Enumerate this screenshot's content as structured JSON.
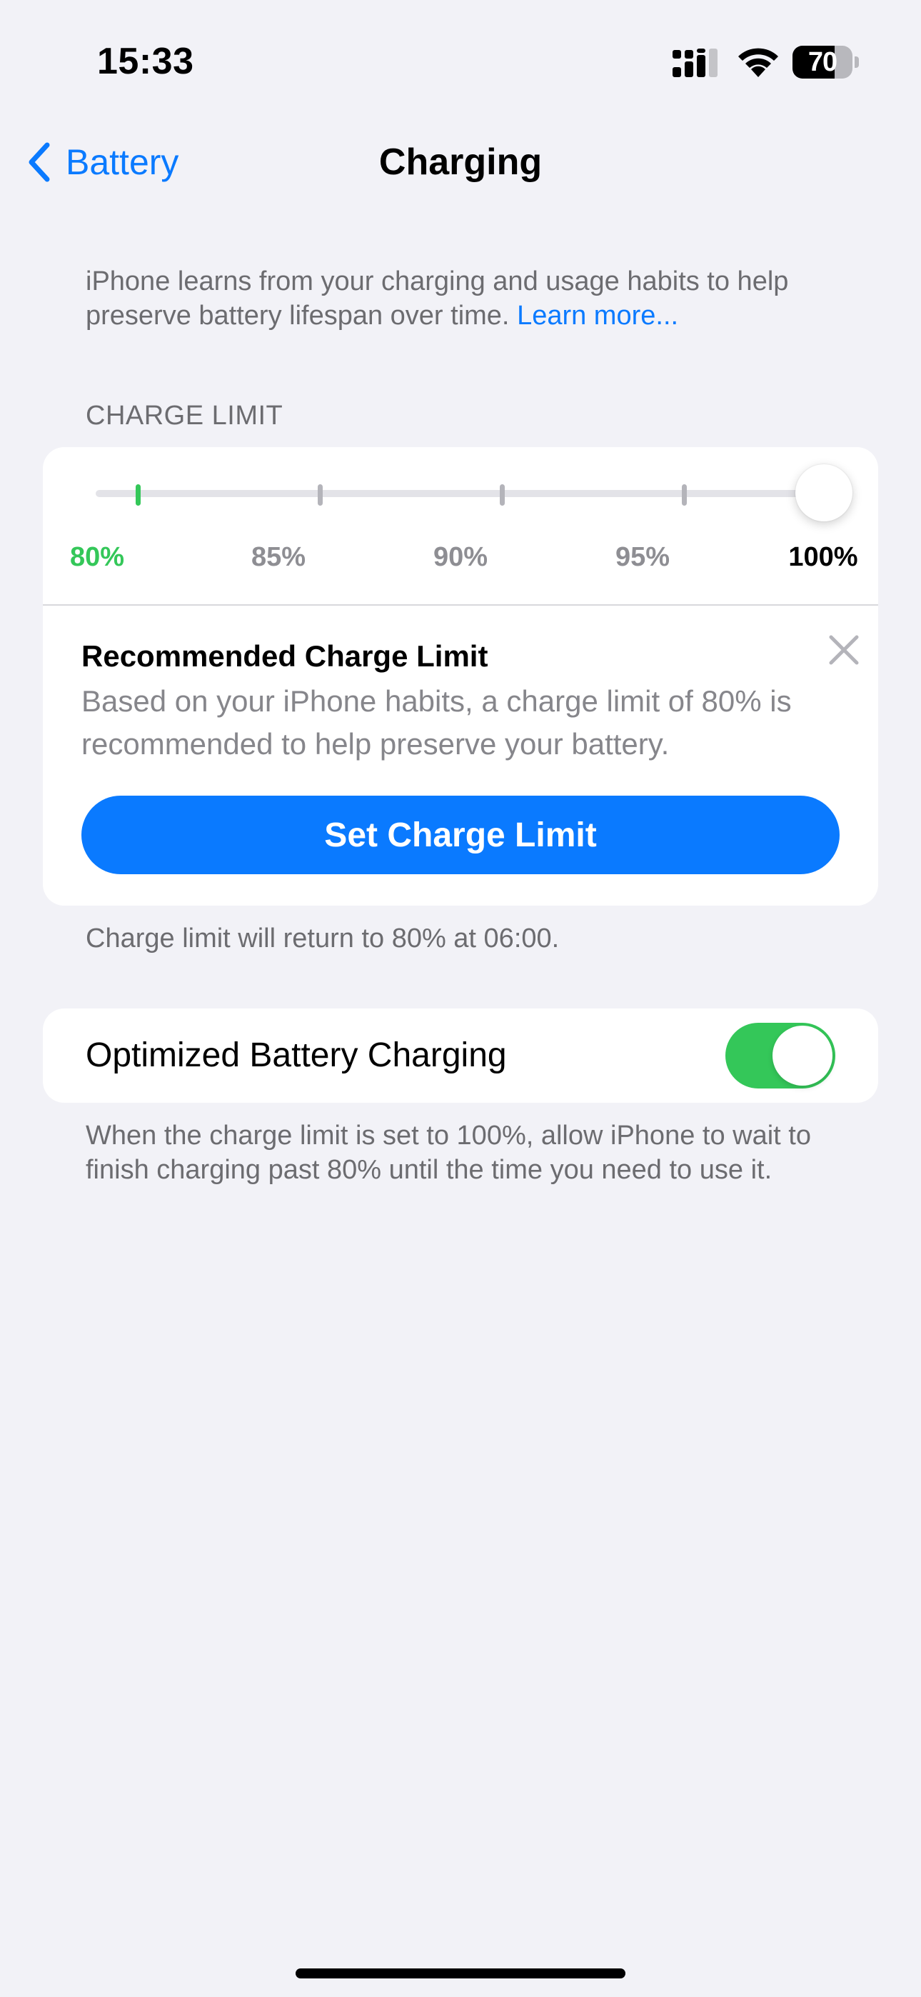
{
  "status_bar": {
    "time": "15:33",
    "battery_percent": "70",
    "battery_level": 0.7
  },
  "nav": {
    "back_label": "Battery",
    "title": "Charging"
  },
  "intro": {
    "text": "iPhone learns from your charging and usage habits to help preserve battery lifespan over time.",
    "link": "Learn more..."
  },
  "charge_limit": {
    "header": "CHARGE LIMIT",
    "options": [
      "80%",
      "85%",
      "90%",
      "95%",
      "100%"
    ],
    "selected": "100%",
    "recommended": "80%"
  },
  "recommendation": {
    "title": "Recommended Charge Limit",
    "description": "Based on your iPhone habits, a charge limit of 80% is recommended to help preserve your battery.",
    "button_label": "Set Charge Limit"
  },
  "footnote": "Charge limit will return to 80% at 06:00.",
  "optimized_charging": {
    "label": "Optimized Battery Charging",
    "enabled": true,
    "description": "When the charge limit is set to 100%, allow iPhone to wait to finish charging past 80% until the time you need to use it."
  },
  "colors": {
    "accent": "#0a7aff",
    "green": "#34c759",
    "background": "#f2f2f7"
  }
}
